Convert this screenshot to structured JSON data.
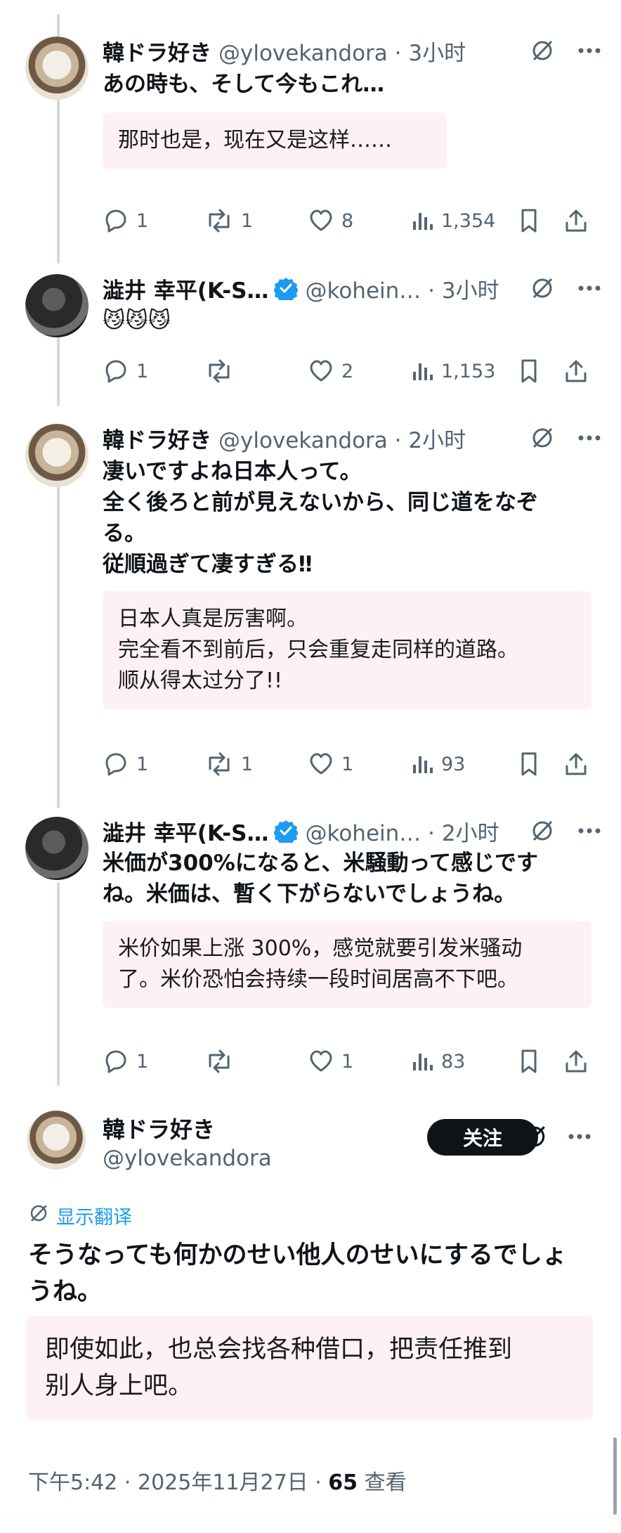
{
  "tweets": [
    {
      "name": "韓ドラ好き",
      "handle": "@ylovekandora · 3小时",
      "text": "あの時も、そして今もこれ…",
      "translation": "那时也是，现在又是这样……",
      "replies": "1",
      "retweets": "1",
      "likes": "8",
      "views": "1,354"
    },
    {
      "name": "澁井 幸平(K-S…",
      "handle": "@kohein… · 3小时",
      "text": "😼😼😼",
      "replies": "1",
      "retweets": "",
      "likes": "2",
      "views": "1,153"
    },
    {
      "name": "韓ドラ好き",
      "handle": "@ylovekandora · 2小时",
      "text_lines": [
        "凄いですよね日本人って。",
        "全く後ろと前が見えないから、同じ道をなぞ",
        "る。",
        "従順過ぎて凄すぎる‼︎"
      ],
      "translation_lines": [
        "日本人真是厉害啊。",
        "完全看不到前后，只会重复走同样的道路。",
        "顺从得太过分了!!"
      ],
      "replies": "1",
      "retweets": "1",
      "likes": "1",
      "views": "93"
    },
    {
      "name": "澁井 幸平(K-S…",
      "handle": "@kohein… · 2小时",
      "text_lines": [
        "米価が300%になると、米騒動って感じです",
        "ね。米価は、暫く下がらないでしょうね。"
      ],
      "translation_lines": [
        "米价如果上涨 300%，感觉就要引发米骚动",
        "了。米价恐怕会持续一段时间居高不下吧。"
      ],
      "replies": "1",
      "retweets": "",
      "likes": "1",
      "views": "83"
    }
  ],
  "main": {
    "name": "韓ドラ好き",
    "handle": "@ylovekandora",
    "follow_label": "关注",
    "show_translation": "显示翻译",
    "text_lines": [
      "そうなっても何かのせい他人のせいにするでしょ",
      "うね。"
    ],
    "translation_lines": [
      "即使如此，也总会找各种借口，把责任推到",
      "别人身上吧。"
    ],
    "timestamp": "下午5:42 · 2025年11月27日 · ",
    "view_count": "65",
    "view_label": " 查看"
  },
  "colors": {
    "accent": "#1d9bf0",
    "text": "#0f1419",
    "muted": "#536471",
    "translation_bg": "#fdf1f3"
  }
}
